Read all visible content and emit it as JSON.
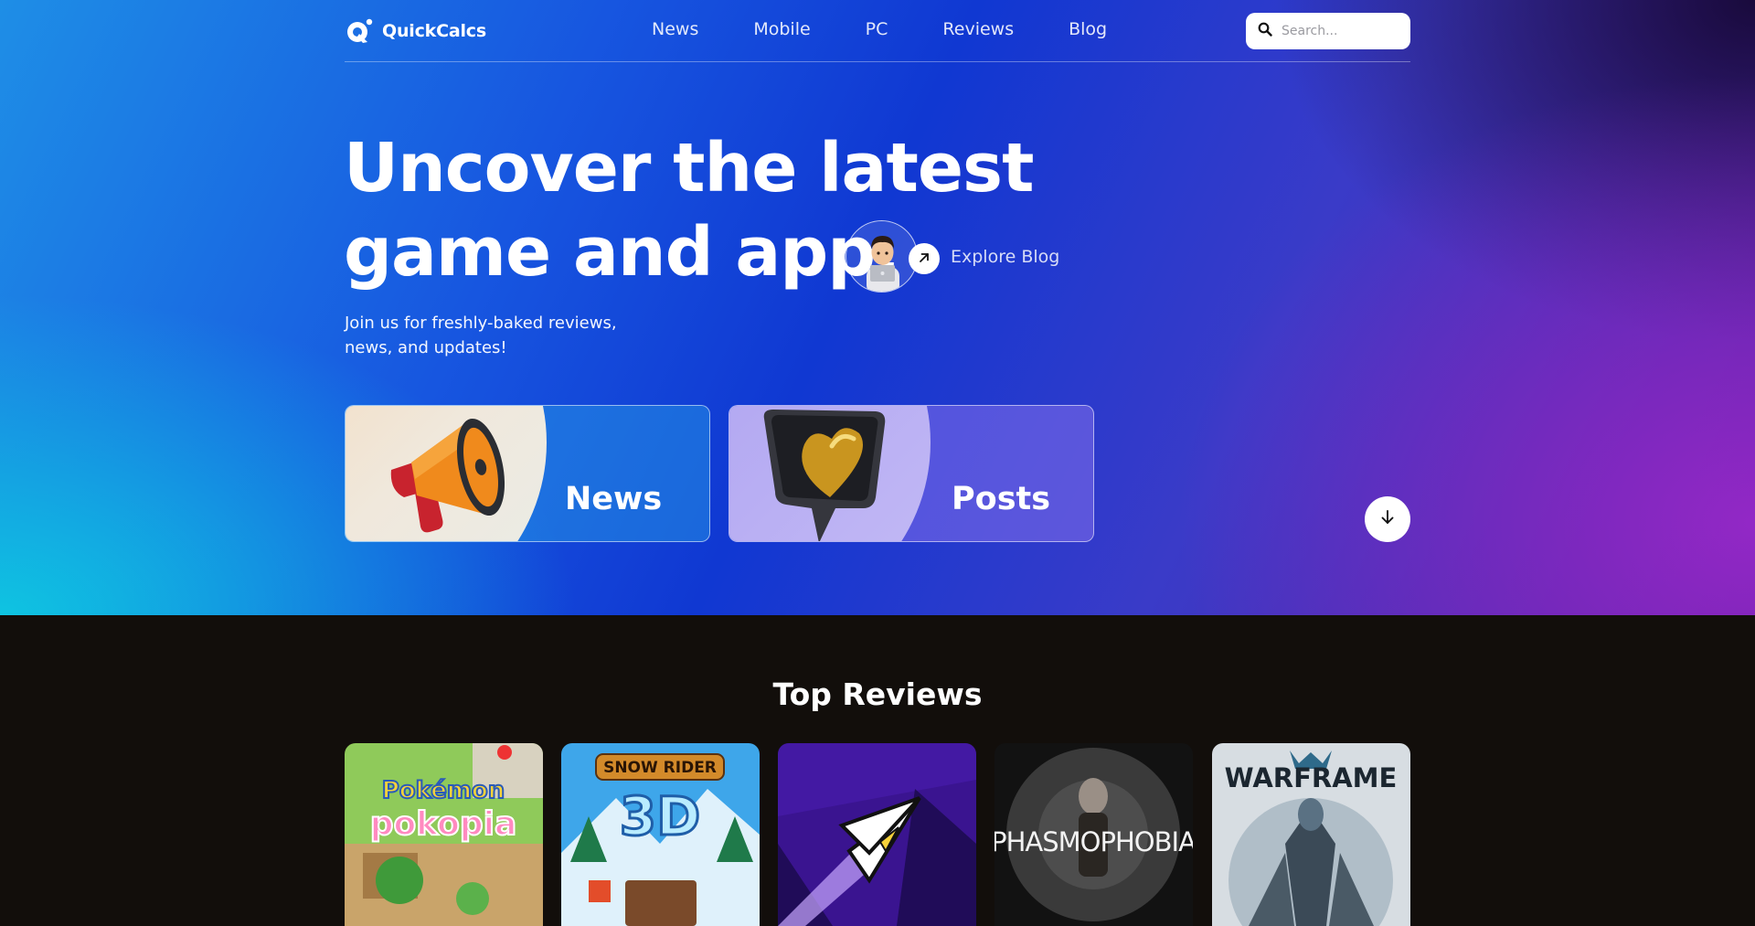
{
  "brand": {
    "name": "QuickCalcs"
  },
  "nav": {
    "items": [
      "News",
      "Mobile",
      "PC",
      "Reviews",
      "Blog"
    ]
  },
  "search": {
    "placeholder": "Search..."
  },
  "hero": {
    "headline_line1": "Uncover the latest",
    "headline_line2": "game and app.",
    "explore_label": "Explore Blog",
    "subtitle_line1": "Join us for freshly-baked reviews,",
    "subtitle_line2": "news, and updates!",
    "cards": [
      {
        "label": "News",
        "icon": "megaphone-icon"
      },
      {
        "label": "Posts",
        "icon": "heart-message-icon"
      }
    ]
  },
  "reviews": {
    "title": "Top Reviews",
    "items": [
      {
        "art_text": "Pokémon Pokopia"
      },
      {
        "art_text_top": "SNOW RIDER",
        "art_text_main": "3D"
      },
      {
        "art_text": ""
      },
      {
        "art_text": "PHASMOPHOBIA"
      },
      {
        "art_text": "WARFRAME"
      }
    ]
  },
  "colors": {
    "accent_blue": "#1038d2",
    "accent_purple": "#55209e",
    "cyan": "#0ec8e1",
    "dark_bg": "#120e0b"
  }
}
